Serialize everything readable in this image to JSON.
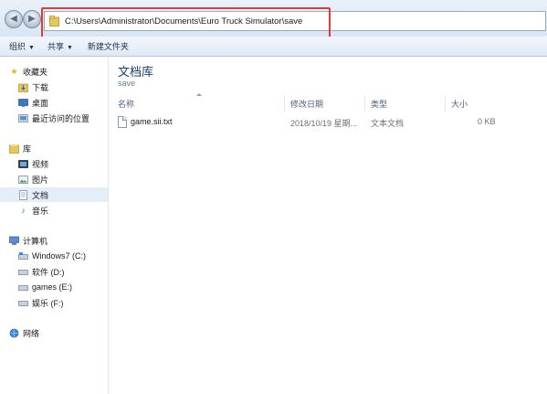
{
  "address": {
    "path": "C:\\Users\\Administrator\\Documents\\Euro Truck Simulator\\save"
  },
  "toolbar": {
    "organize": "组织",
    "share": "共享",
    "new_folder": "新建文件夹"
  },
  "sidebar": {
    "favorites": {
      "label": "收藏夹",
      "items": [
        {
          "label": "下载"
        },
        {
          "label": "桌面"
        },
        {
          "label": "最近访问的位置"
        }
      ]
    },
    "libraries": {
      "label": "库",
      "items": [
        {
          "label": "视频"
        },
        {
          "label": "图片"
        },
        {
          "label": "文档"
        },
        {
          "label": "音乐"
        }
      ]
    },
    "computer": {
      "label": "计算机",
      "items": [
        {
          "label": "Windows7 (C:)"
        },
        {
          "label": "软件 (D:)"
        },
        {
          "label": "games (E:)"
        },
        {
          "label": "娱乐 (F:)"
        }
      ]
    },
    "network": {
      "label": "网络"
    }
  },
  "main": {
    "title": "文档库",
    "subtitle": "save",
    "columns": {
      "name": "名称",
      "date": "修改日期",
      "type": "类型",
      "size": "大小"
    },
    "files": [
      {
        "name": "game.sii.txt",
        "date": "2018/10/19 星期...",
        "type": "文本文档",
        "size": "0 KB"
      }
    ]
  },
  "colors": {
    "highlight_border": "#e03a3a",
    "selected_bg": "#e3eef9",
    "title_color": "#1e3f6f"
  }
}
